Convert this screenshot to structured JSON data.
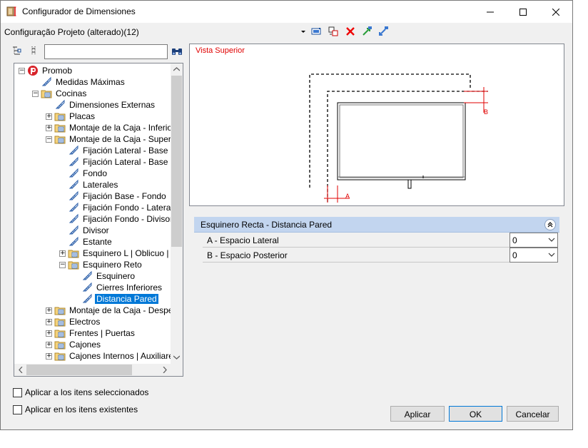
{
  "window": {
    "title": "Configurador de Dimensiones"
  },
  "toolbar": {
    "config_title": "Configuração Projeto (alterado)(12)"
  },
  "search": {
    "value": ""
  },
  "tree": {
    "items": [
      {
        "label": "Promob",
        "level": 0,
        "expander": "−",
        "icon": "promob-logo-icon"
      },
      {
        "label": "Medidas Máximas",
        "level": 1,
        "expander": "",
        "icon": "tag-icon"
      },
      {
        "label": "Cocinas",
        "level": 1,
        "expander": "−",
        "icon": "folder-icon"
      },
      {
        "label": "Dimensiones Externas",
        "level": 2,
        "expander": "",
        "icon": "tag-icon"
      },
      {
        "label": "Placas",
        "level": 2,
        "expander": "+",
        "icon": "folder-icon"
      },
      {
        "label": "Montaje de la Caja - Inferior",
        "level": 2,
        "expander": "+",
        "icon": "folder-icon"
      },
      {
        "label": "Montaje de la Caja - Superior",
        "level": 2,
        "expander": "−",
        "icon": "folder-icon"
      },
      {
        "label": "Fijación Lateral - Base Inf",
        "level": 3,
        "expander": "",
        "icon": "tag-icon"
      },
      {
        "label": "Fijación Lateral - Base Su",
        "level": 3,
        "expander": "",
        "icon": "tag-icon"
      },
      {
        "label": "Fondo",
        "level": 3,
        "expander": "",
        "icon": "tag-icon"
      },
      {
        "label": "Laterales",
        "level": 3,
        "expander": "",
        "icon": "tag-icon"
      },
      {
        "label": " Fijación Base - Fondo",
        "level": 3,
        "expander": "",
        "icon": "tag-icon"
      },
      {
        "label": "Fijación Fondo - Lateral",
        "level": 3,
        "expander": "",
        "icon": "tag-icon"
      },
      {
        "label": "Fijación Fondo - Divisoria",
        "level": 3,
        "expander": "",
        "icon": "tag-icon"
      },
      {
        "label": "Divisor",
        "level": 3,
        "expander": "",
        "icon": "tag-icon"
      },
      {
        "label": "Estante",
        "level": 3,
        "expander": "",
        "icon": "tag-icon"
      },
      {
        "label": "Esquinero L | Oblicuo | Cu",
        "level": 3,
        "expander": "+",
        "icon": "folder-icon"
      },
      {
        "label": "Esquinero Reto",
        "level": 3,
        "expander": "−",
        "icon": "folder-icon"
      },
      {
        "label": "Esquinero",
        "level": 4,
        "expander": "",
        "icon": "tag-icon"
      },
      {
        "label": "Cierres Inferiores",
        "level": 4,
        "expander": "",
        "icon": "tag-icon"
      },
      {
        "label": "Distancia Pared",
        "level": 4,
        "expander": "",
        "icon": "tag-icon",
        "selected": true
      },
      {
        "label": "Montaje de la Caja - Despens",
        "level": 2,
        "expander": "+",
        "icon": "folder-icon"
      },
      {
        "label": "Electros",
        "level": 2,
        "expander": "+",
        "icon": "folder-icon"
      },
      {
        "label": "Frentes | Puertas",
        "level": 2,
        "expander": "+",
        "icon": "folder-icon"
      },
      {
        "label": "Cajones",
        "level": 2,
        "expander": "+",
        "icon": "folder-icon"
      },
      {
        "label": "Cajones Internos | Auxiliares",
        "level": 2,
        "expander": "+",
        "icon": "folder-icon"
      }
    ]
  },
  "preview": {
    "title": "Vista Superior",
    "label_a": "A",
    "label_b": "B"
  },
  "properties": {
    "header": "Esquinero Recta - Distancia Pared",
    "rows": [
      {
        "label": "A - Espacio Lateral",
        "value": "0"
      },
      {
        "label": "B - Espacio Posterior",
        "value": "0"
      }
    ]
  },
  "options": {
    "apply_selected": "Aplicar a los itens seleccionados",
    "apply_existing": "Aplicar en los itens existentes"
  },
  "buttons": {
    "apply": "Aplicar",
    "ok": "OK",
    "cancel": "Cancelar"
  },
  "colors": {
    "accent": "#0078d7",
    "header_bg": "#c2d5ef",
    "preview_title": "#e00000"
  }
}
